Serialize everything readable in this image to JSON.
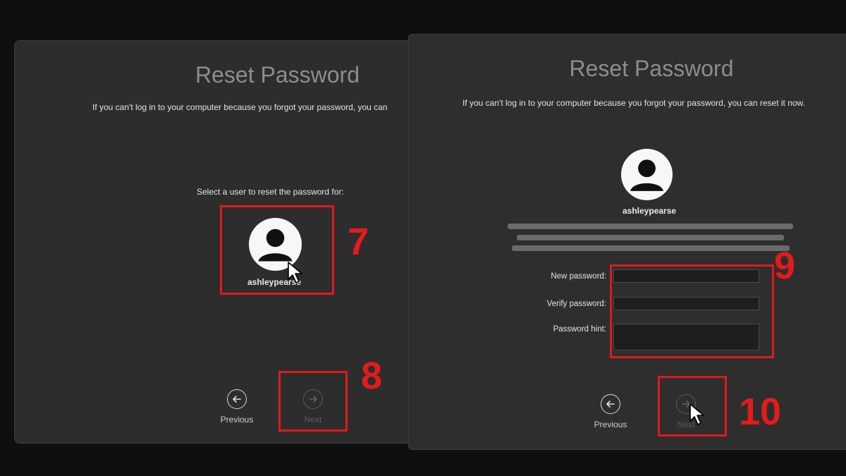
{
  "left": {
    "title": "Reset Password",
    "subtitle": "If you can't log in to your computer because you forgot your password, you can",
    "prompt": "Select a user to reset the password for:",
    "username": "ashleypearse",
    "icons": [
      "user-avatar-icon",
      "arrow-left-icon",
      "arrow-right-icon",
      "pointer-cursor-icon"
    ],
    "previous_label": "Previous",
    "next_label": "Next",
    "step_a": "7",
    "step_b": "8"
  },
  "right": {
    "title": "Reset Password",
    "subtitle": "If you can't log in to your computer because you forgot your password, you can reset it now.",
    "username": "ashleypearse",
    "fields": {
      "new_password_label": "New password:",
      "verify_password_label": "Verify password:",
      "password_hint_label": "Password hint:"
    },
    "previous_label": "Previous",
    "next_label": "Next",
    "step_a": "9",
    "step_b": "10"
  },
  "colors": {
    "annotation": "#e0191b",
    "panel": "#2d2d2d",
    "background": "#0f0f0f"
  }
}
